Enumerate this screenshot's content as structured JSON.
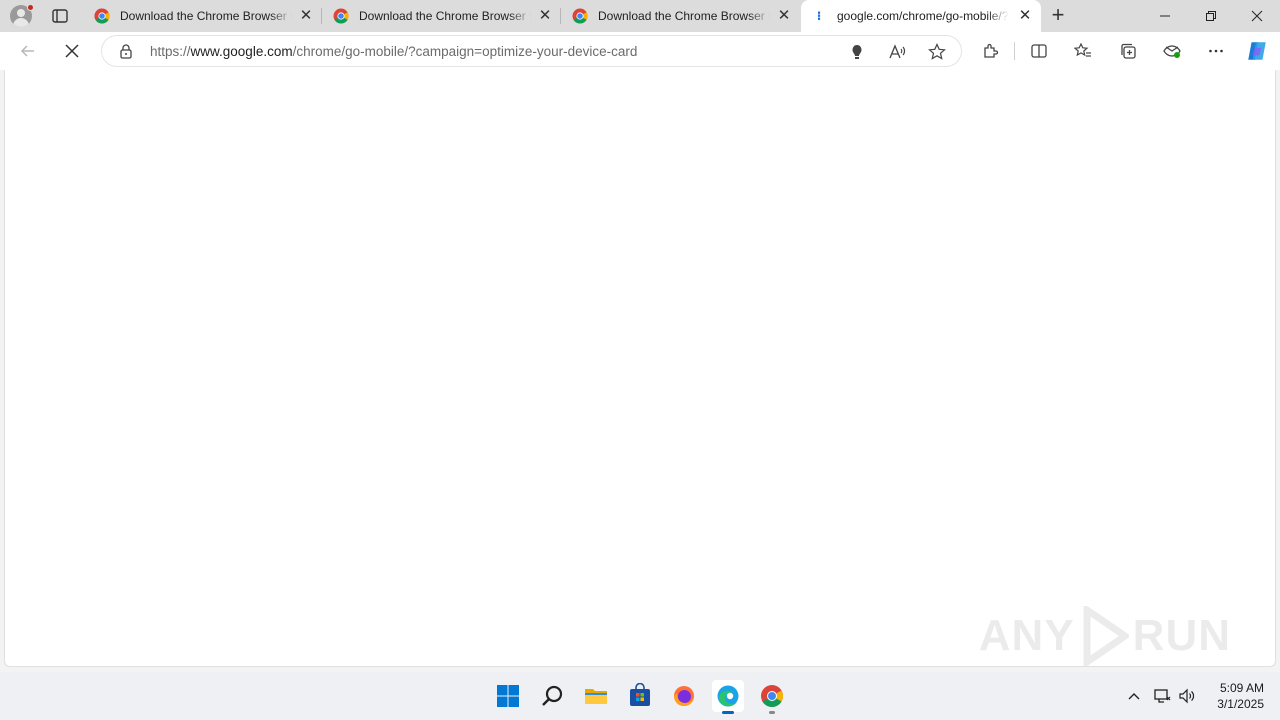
{
  "tabs": [
    {
      "title": "Download the Chrome Browser for",
      "icon": "chrome-icon",
      "active": false
    },
    {
      "title": "Download the Chrome Browser for",
      "icon": "chrome-icon",
      "active": false
    },
    {
      "title": "Download the Chrome Browser for",
      "icon": "chrome-icon",
      "active": false
    },
    {
      "title": "google.com/chrome/go-mobile/?campaign",
      "icon": "loading-icon",
      "active": true
    }
  ],
  "loading_glyph": "⁝",
  "address_bar": {
    "scheme": "https://",
    "host": "www.google.com",
    "path": "/chrome/go-mobile/?campaign=optimize-your-device-card"
  },
  "watermark": {
    "left": "ANY",
    "right": "RUN"
  },
  "clock": {
    "time": "5:09 AM",
    "date": "3/1/2025"
  },
  "colors": {
    "accent": "#0067c0",
    "loading": "#1a73e8",
    "tabstrip": "#dcdcdc",
    "taskbar": "#eef0f3"
  }
}
